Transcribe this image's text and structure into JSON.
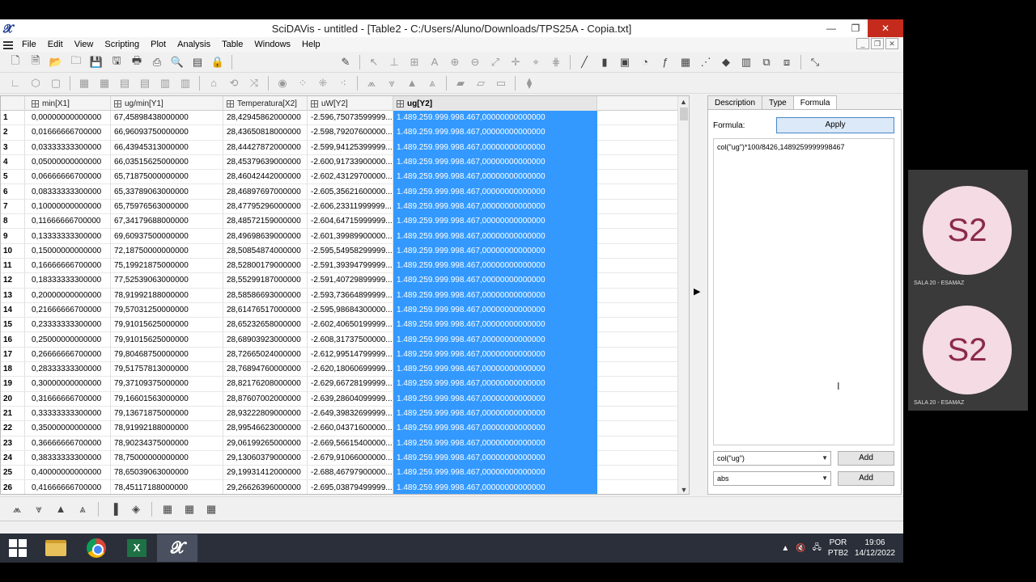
{
  "window": {
    "title": "SciDAVis - untitled - [Table2 - C:/Users/Aluno/Downloads/TPS25A - Copia.txt]",
    "min": "—",
    "restore": "❐",
    "close": "✕"
  },
  "menu": [
    "File",
    "Edit",
    "View",
    "Scripting",
    "Plot",
    "Analysis",
    "Table",
    "Windows",
    "Help"
  ],
  "table": {
    "columns": [
      "min[X1]",
      "ug/min[Y1]",
      "Temperatura[X2]",
      "uW[Y2]",
      "ug[Y2]"
    ],
    "rows": [
      [
        "1",
        "0,00000000000000",
        "67,45898438000000",
        "28,42945862000000",
        "-2.596,75073599999...",
        "1.489.259.999.998.467,00000000000000"
      ],
      [
        "2",
        "0,01666666700000",
        "66,96093750000000",
        "28,43650818000000",
        "-2.598,79207600000...",
        "1.489.259.999.998.467,00000000000000"
      ],
      [
        "3",
        "0,03333333300000",
        "66,43945313000000",
        "28,44427872000000",
        "-2.599,94125399999...",
        "1.489.259.999.998.467,00000000000000"
      ],
      [
        "4",
        "0,05000000000000",
        "66,03515625000000",
        "28,45379639000000",
        "-2.600,91733900000...",
        "1.489.259.999.998.467,00000000000000"
      ],
      [
        "5",
        "0,06666666700000",
        "65,71875000000000",
        "28,46042442000000",
        "-2.602,43129700000...",
        "1.489.259.999.998.467,00000000000000"
      ],
      [
        "6",
        "0,08333333300000",
        "65,33789063000000",
        "28,46897697000000",
        "-2.605,35621600000...",
        "1.489.259.999.998.467,00000000000000"
      ],
      [
        "7",
        "0,10000000000000",
        "65,75976563000000",
        "28,47795296000000",
        "-2.606,23311999999...",
        "1.489.259.999.998.467,00000000000000"
      ],
      [
        "8",
        "0,11666666700000",
        "67,34179688000000",
        "28,48572159000000",
        "-2.604,64715999999...",
        "1.489.259.999.998.467,00000000000000"
      ],
      [
        "9",
        "0,13333333300000",
        "69,60937500000000",
        "28,49698639000000",
        "-2.601,39989900000...",
        "1.489.259.999.998.467,00000000000000"
      ],
      [
        "10",
        "0,15000000000000",
        "72,18750000000000",
        "28,50854874000000",
        "-2.595,54958299999...",
        "1.489.259.999.998.467,00000000000000"
      ],
      [
        "11",
        "0,16666666700000",
        "75,19921875000000",
        "28,52800179000000",
        "-2.591,39394799999...",
        "1.489.259.999.998.467,00000000000000"
      ],
      [
        "12",
        "0,18333333300000",
        "77,52539063000000",
        "28,55299187000000",
        "-2.591,40729899999...",
        "1.489.259.999.998.467,00000000000000"
      ],
      [
        "13",
        "0,20000000000000",
        "78,91992188000000",
        "28,58586693000000",
        "-2.593,73664899999...",
        "1.489.259.999.998.467,00000000000000"
      ],
      [
        "14",
        "0,21666666700000",
        "79,57031250000000",
        "28,61476517000000",
        "-2.595,98684300000...",
        "1.489.259.999.998.467,00000000000000"
      ],
      [
        "15",
        "0,23333333300000",
        "79,91015625000000",
        "28,65232658000000",
        "-2.602,40650199999...",
        "1.489.259.999.998.467,00000000000000"
      ],
      [
        "16",
        "0,25000000000000",
        "79,91015625000000",
        "28,68903923000000",
        "-2.608,31737500000...",
        "1.489.259.999.998.467,00000000000000"
      ],
      [
        "17",
        "0,26666666700000",
        "79,80468750000000",
        "28,72665024000000",
        "-2.612,99514799999...",
        "1.489.259.999.998.467,00000000000000"
      ],
      [
        "18",
        "0,28333333300000",
        "79,51757813000000",
        "28,76894760000000",
        "-2.620,18060699999...",
        "1.489.259.999.998.467,00000000000000"
      ],
      [
        "19",
        "0,30000000000000",
        "79,37109375000000",
        "28,82176208000000",
        "-2.629,66728199999...",
        "1.489.259.999.998.467,00000000000000"
      ],
      [
        "20",
        "0,31666666700000",
        "79,16601563000000",
        "28,87607002000000",
        "-2.639,28604099999...",
        "1.489.259.999.998.467,00000000000000"
      ],
      [
        "21",
        "0,33333333300000",
        "79,13671875000000",
        "28,93222809000000",
        "-2.649,39832699999...",
        "1.489.259.999.998.467,00000000000000"
      ],
      [
        "22",
        "0,35000000000000",
        "78,91992188000000",
        "28,99546623000000",
        "-2.660,04371600000...",
        "1.489.259.999.998.467,00000000000000"
      ],
      [
        "23",
        "0,36666666700000",
        "78,90234375000000",
        "29,06199265000000",
        "-2.669,56615400000...",
        "1.489.259.999.998.467,00000000000000"
      ],
      [
        "24",
        "0,38333333300000",
        "78,75000000000000",
        "29,13060379000000",
        "-2.679,91066000000...",
        "1.489.259.999.998.467,00000000000000"
      ],
      [
        "25",
        "0,40000000000000",
        "78,65039063000000",
        "29,19931412000000",
        "-2.688,46797900000...",
        "1.489.259.999.998.467,00000000000000"
      ],
      [
        "26",
        "0,41666666700000",
        "78,45117188000000",
        "29,26626396000000",
        "-2.695,03879499999...",
        "1.489.259.999.998.467,00000000000000"
      ]
    ]
  },
  "panel": {
    "tabs": [
      "Description",
      "Type",
      "Formula"
    ],
    "formula_label": "Formula:",
    "apply_label": "Apply",
    "formula_text": "col(\"ug\")*100/8426,1489259999998467",
    "select1": "col(\"ug\")",
    "select2": "abs",
    "add_label": "Add"
  },
  "taskbar": {
    "lang1": "POR",
    "lang2": "PTB2",
    "time": "19:06",
    "date": "14/12/2022"
  },
  "participants": [
    {
      "initials": "S2",
      "label": "SALA 20 - ESAMAZ"
    },
    {
      "initials": "S2",
      "label": "SALA 20 - ESAMAZ"
    }
  ],
  "colors": {
    "selection": "#3399ff",
    "close": "#c42b1c",
    "taskbar": "#2a2f3a"
  }
}
